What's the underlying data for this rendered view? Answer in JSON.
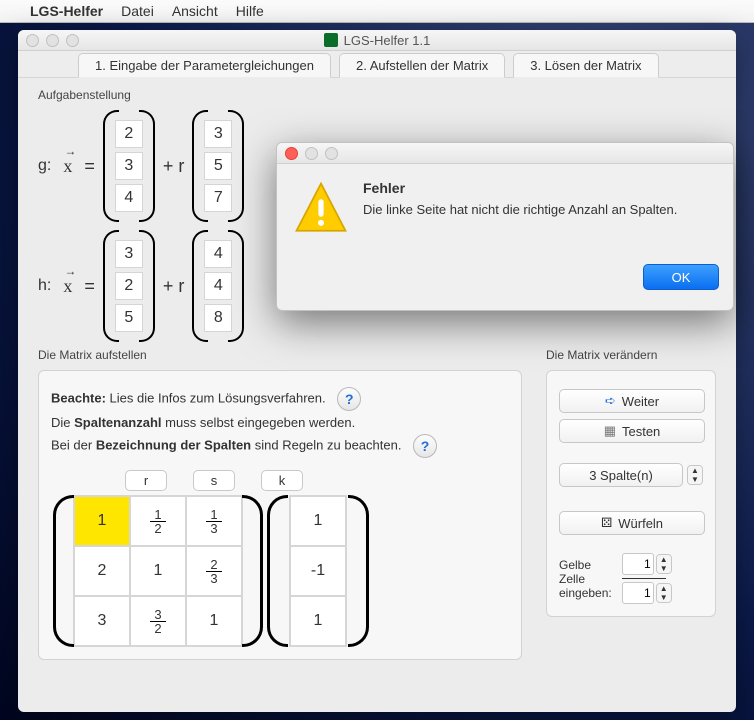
{
  "menubar": {
    "app_name": "LGS-Helfer",
    "items": [
      "Datei",
      "Ansicht",
      "Hilfe"
    ]
  },
  "window": {
    "title": "LGS-Helfer 1.1",
    "tabs": [
      "1. Eingabe der Parametergleichungen",
      "2. Aufstellen der Matrix",
      "3. Lösen der Matrix"
    ]
  },
  "task": {
    "label": "Aufgabenstellung",
    "g": {
      "label": "g:",
      "support": [
        "2",
        "3",
        "4"
      ],
      "dir": [
        "3",
        "5",
        "7"
      ],
      "param": "+ r"
    },
    "h": {
      "label": "h:",
      "support": [
        "3",
        "2",
        "5"
      ],
      "dir": [
        "4",
        "4",
        "8"
      ],
      "param": "+ r"
    }
  },
  "setup": {
    "section_label": "Die Matrix aufstellen",
    "line1_a": "Beachte:",
    "line1_b": " Lies die Infos zum Lösungsverfahren.",
    "line2_a": "Die ",
    "line2_b": "Spaltenanzahl",
    "line2_c": " muss selbst eingegeben werden.",
    "line3_a": "Bei der ",
    "line3_b": "Bezeichnung der Spalten",
    "line3_c": " sind Regeln zu beachten.",
    "headers": [
      "r",
      "s",
      "k"
    ],
    "matrix": [
      [
        "1",
        "1/2",
        "1/3"
      ],
      [
        "2",
        "1",
        "2/3"
      ],
      [
        "3",
        "3/2",
        "1"
      ]
    ],
    "rhs": [
      "1",
      "-1",
      "1"
    ]
  },
  "modify": {
    "section_label": "Die Matrix verändern",
    "btn_next": "Weiter",
    "btn_test": "Testen",
    "btn_dice": "Würfeln",
    "spalten_prefix": "3 Spalte(n)",
    "yellow_label_a": "Gelbe",
    "yellow_label_b": "Zelle",
    "yellow_label_c": "eingeben:",
    "yellow_num": "1",
    "yellow_den": "1"
  },
  "dialog": {
    "title": "Fehler",
    "message": "Die linke Seite hat nicht die richtige Anzahl an Spalten.",
    "ok": "OK"
  }
}
